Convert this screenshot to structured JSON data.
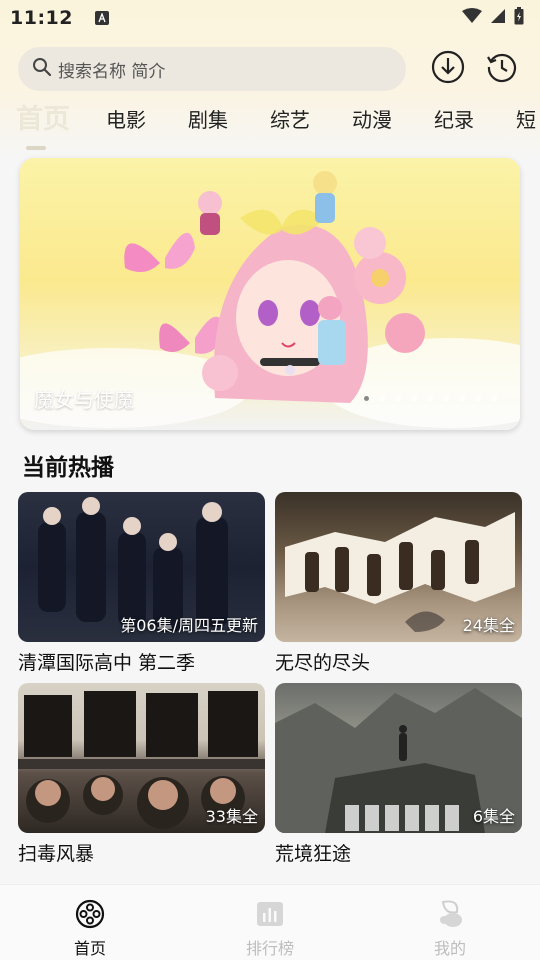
{
  "status_bar": {
    "time": "11:12",
    "icons": [
      "wifi-icon",
      "signal-icon",
      "battery-icon"
    ]
  },
  "search": {
    "placeholder": "搜索名称 简介"
  },
  "header_actions": [
    "download-icon",
    "history-icon"
  ],
  "tabs": [
    {
      "label": "首页",
      "active": true
    },
    {
      "label": "电影",
      "active": false
    },
    {
      "label": "剧集",
      "active": false
    },
    {
      "label": "综艺",
      "active": false
    },
    {
      "label": "动漫",
      "active": false
    },
    {
      "label": "纪录",
      "active": false
    },
    {
      "label": "短",
      "active": false
    }
  ],
  "banner": {
    "title": "魔女与使魔",
    "dot_count": 9,
    "active_dot": 0
  },
  "section": {
    "title": "当前热播"
  },
  "cards": [
    {
      "title": "清潭国际高中 第二季",
      "badge": "第06集/周四五更新"
    },
    {
      "title": "无尽的尽头",
      "badge": "24集全"
    },
    {
      "title": "扫毒风暴",
      "badge": "33集全"
    },
    {
      "title": "荒境狂途",
      "badge": "6集全"
    }
  ],
  "bottom_nav": [
    {
      "label": "首页",
      "icon": "film-reel-icon",
      "active": true
    },
    {
      "label": "排行榜",
      "icon": "ranking-chart-icon",
      "active": false
    },
    {
      "label": "我的",
      "icon": "profile-icon",
      "active": false
    }
  ],
  "colors": {
    "accent_active_tab": "#ece7d7",
    "search_bg": "#ece8df",
    "nav_inactive": "#bdbdbd"
  }
}
